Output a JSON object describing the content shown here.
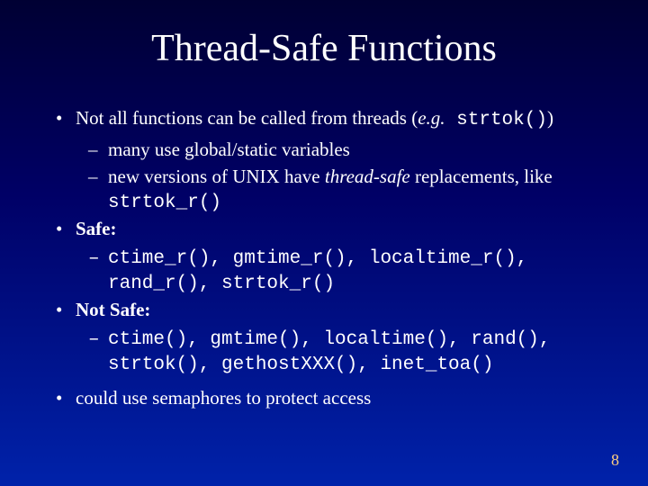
{
  "title": "Thread-Safe Functions",
  "b1_intro_pre": "Not all functions can be called from threads (",
  "b1_intro_eg": "e.g.",
  "b1_intro_code": " strtok()",
  "b1_intro_post": ")",
  "sub_global": "many use global/static variables",
  "sub_unix_pre": "new versions of UNIX have ",
  "sub_unix_ts": "thread-safe",
  "sub_unix_post": " replacements, like ",
  "sub_unix_code": "strtok_r()",
  "safe_label": "Safe:",
  "safe_list": "ctime_r(), gmtime_r(), localtime_r(), rand_r(), strtok_r()",
  "notsafe_label": "Not Safe:",
  "notsafe_list": "ctime(), gmtime(), localtime(), rand(), strtok(), gethostXXX(), inet_toa()",
  "sema": "could use semaphores to protect access",
  "pagenum": "8"
}
